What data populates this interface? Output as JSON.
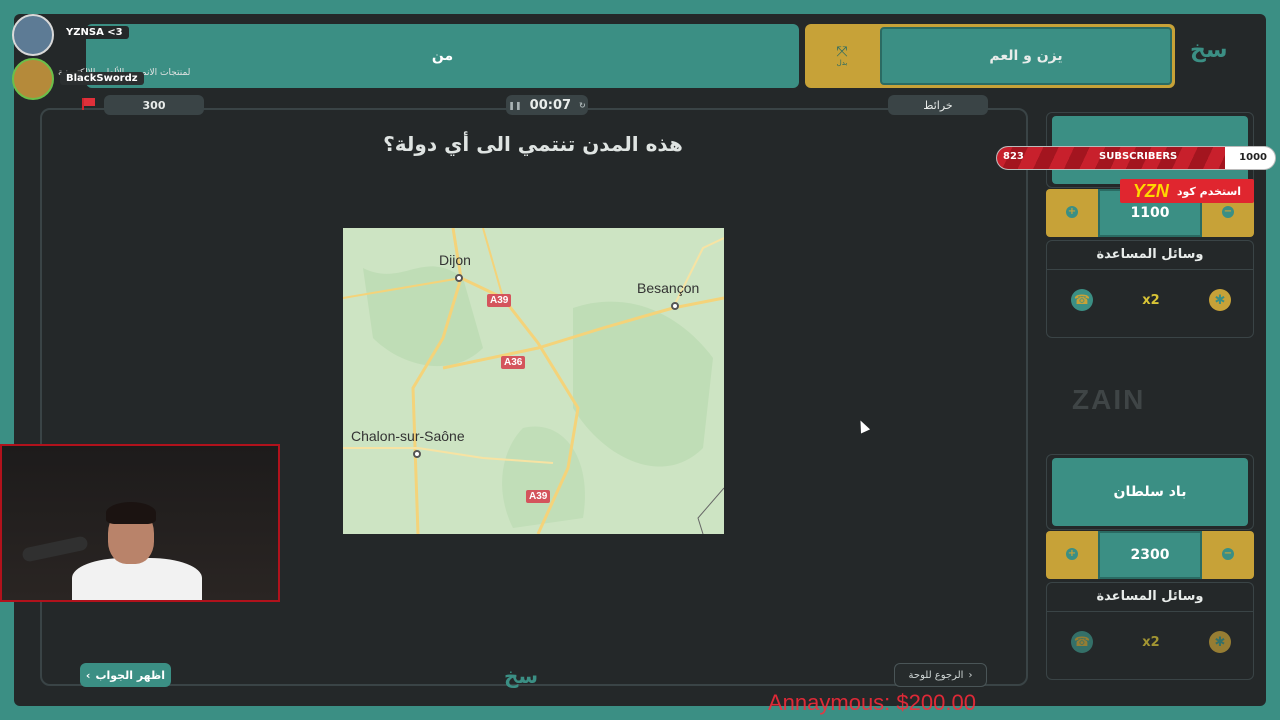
{
  "teams": {
    "left_team_name": "من",
    "right_team_name": "يزن و العم",
    "swap_label": "بدل"
  },
  "board": {
    "score": "300",
    "category": "خرائط",
    "timer": "00:07",
    "question": "هذه المدن تنتمي الى أي دولة؟",
    "show_answer_label": "اظهر الجواب",
    "back_label": "الرجوع للوحة"
  },
  "map": {
    "cities": [
      "Dijon",
      "Besançon",
      "Chalon-sur-Saône"
    ],
    "roads": [
      "A39",
      "A36",
      "A39"
    ]
  },
  "side_panels": {
    "team1": {
      "name": "",
      "score": "1100",
      "help_title": "وسائل المساعدة"
    },
    "team2": {
      "name": "باد سلطان",
      "score": "2300",
      "help_title": "وسائل المساعدة"
    },
    "double_tool_label": "x2",
    "sponsor": "ZAIN"
  },
  "overlay": {
    "subs_current": "823",
    "subs_label": "SUBSCRIBERS",
    "subs_goal": "1000",
    "promo_code": "YZN",
    "promo_text": "استخدم كود",
    "chat": [
      {
        "user": "YZNSA <3",
        "message": ""
      },
      {
        "user": "BlackSwordz",
        "message": "لمنتجات الانمي و الألعاب الالكترونية"
      }
    ],
    "donation": "Annaymous: $200.00"
  },
  "colors": {
    "teal": "#3b8f84",
    "gold": "#c7a238",
    "background": "#242829",
    "alert_red": "#e0262f"
  }
}
